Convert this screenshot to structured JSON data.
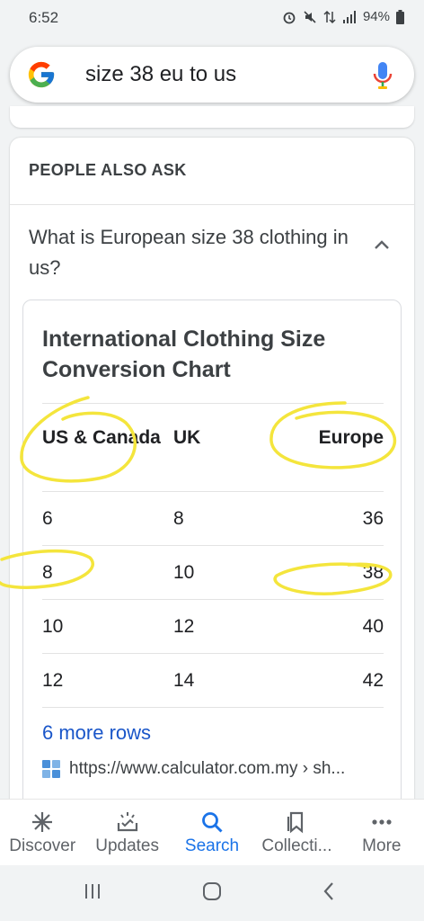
{
  "status": {
    "time": "6:52",
    "battery": "94%"
  },
  "search": {
    "query": "size 38 eu to us"
  },
  "paa": {
    "heading": "PEOPLE ALSO ASK",
    "question": "What is European size 38 clothing in us?",
    "answer": {
      "title": "International Clothing Size Conversion Chart",
      "columns": [
        "US & Canada",
        "UK",
        "Europe"
      ],
      "rows": [
        [
          "6",
          "8",
          "36"
        ],
        [
          "8",
          "10",
          "38"
        ],
        [
          "10",
          "12",
          "40"
        ],
        [
          "12",
          "14",
          "42"
        ]
      ],
      "more_rows": "6 more rows",
      "source": "https://www.calculator.com.my › sh..."
    }
  },
  "bottom_nav": {
    "items": [
      {
        "label": "Discover",
        "icon": "asterisk-icon"
      },
      {
        "label": "Updates",
        "icon": "updates-icon"
      },
      {
        "label": "Search",
        "icon": "search-icon"
      },
      {
        "label": "Collecti...",
        "icon": "bookmark-icon"
      },
      {
        "label": "More",
        "icon": "more-dots-icon"
      }
    ]
  },
  "colors": {
    "accent": "#1a73e8",
    "annotation": "#f4e53c",
    "link": "#1a56c9"
  }
}
